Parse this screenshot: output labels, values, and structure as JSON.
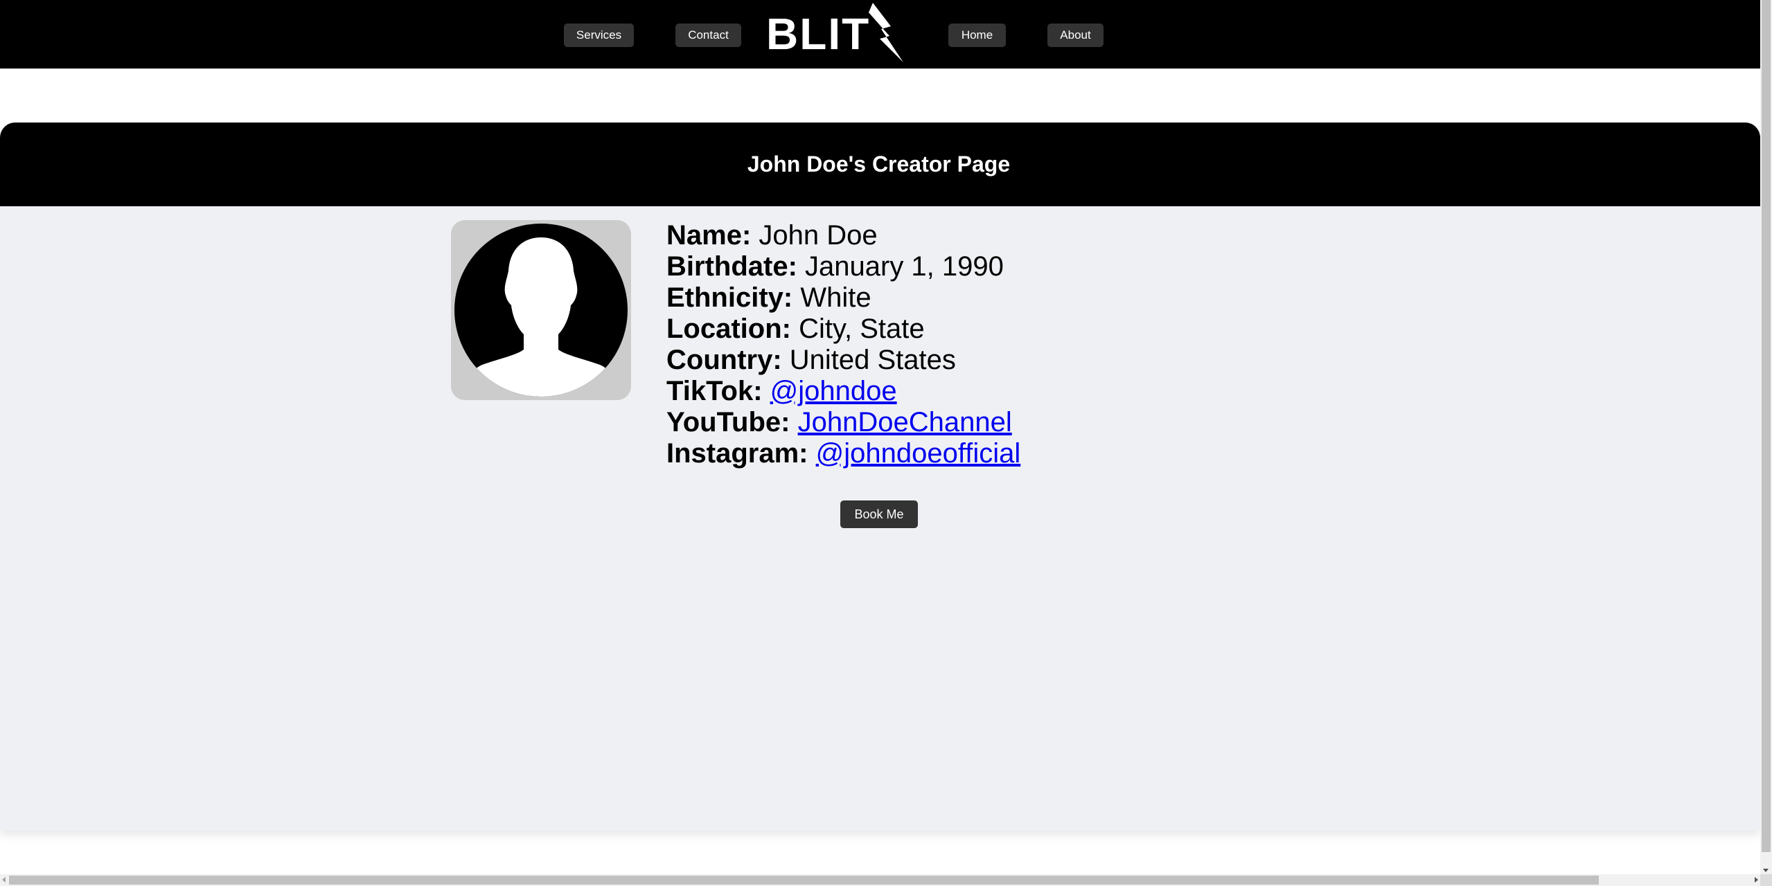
{
  "nav": {
    "services_label": "Services",
    "contact_label": "Contact",
    "home_label": "Home",
    "about_label": "About",
    "logo_text": "BLIT"
  },
  "page": {
    "title": "John Doe's Creator Page"
  },
  "profile": {
    "fields": [
      {
        "label": "Name:",
        "value": "John Doe"
      },
      {
        "label": "Birthdate:",
        "value": "January 1, 1990"
      },
      {
        "label": "Ethnicity:",
        "value": "White"
      },
      {
        "label": "Location:",
        "value": "City, State"
      },
      {
        "label": "Country:",
        "value": "United States"
      }
    ],
    "links": [
      {
        "label": "TikTok:",
        "value": "@johndoe"
      },
      {
        "label": "YouTube:",
        "value": "JohnDoeChannel"
      },
      {
        "label": "Instagram:",
        "value": "@johndoeofficial"
      }
    ],
    "avatar_icon": "person-silhouette-icon"
  },
  "actions": {
    "book_label": "Book Me"
  },
  "colors": {
    "nav_bg": "#000000",
    "button_bg": "#333333",
    "card_bg": "#eff0f4",
    "avatar_frame": "#cccccc",
    "link": "#0000ee"
  }
}
